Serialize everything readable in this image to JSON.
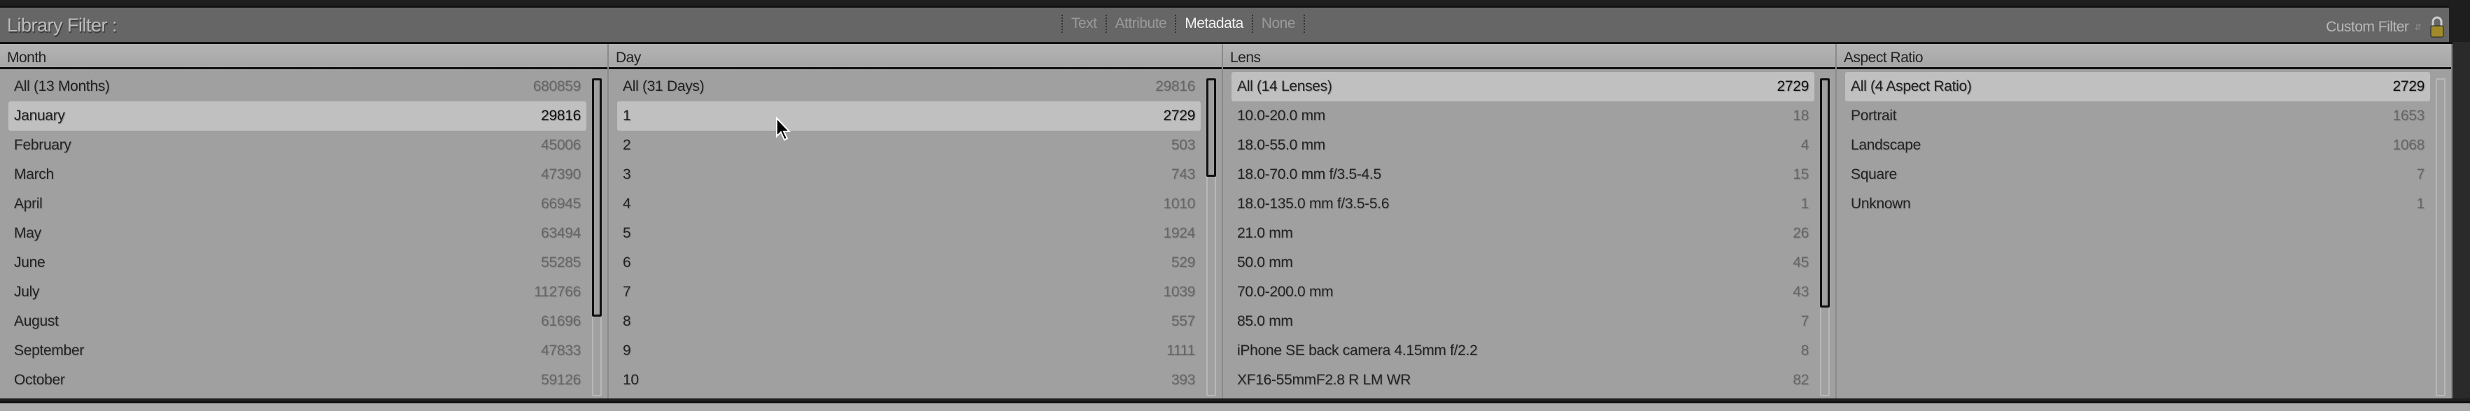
{
  "header": {
    "title": "Library Filter :",
    "modes": [
      "Text",
      "Attribute",
      "Metadata",
      "None"
    ],
    "active_mode": "Metadata",
    "preset": "Custom Filter"
  },
  "columns": [
    {
      "title": "Month",
      "items": [
        {
          "label": "All (13 Months)",
          "count": "680859"
        },
        {
          "label": "January",
          "count": "29816",
          "selected": true
        },
        {
          "label": "February",
          "count": "45006"
        },
        {
          "label": "March",
          "count": "47390"
        },
        {
          "label": "April",
          "count": "66945"
        },
        {
          "label": "May",
          "count": "63494"
        },
        {
          "label": "June",
          "count": "55285"
        },
        {
          "label": "July",
          "count": "112766"
        },
        {
          "label": "August",
          "count": "61696"
        },
        {
          "label": "September",
          "count": "47833"
        },
        {
          "label": "October",
          "count": "59126"
        }
      ],
      "scroll": 0.75
    },
    {
      "title": "Day",
      "items": [
        {
          "label": "All (31 Days)",
          "count": "29816"
        },
        {
          "label": "1",
          "count": "2729",
          "selected": true
        },
        {
          "label": "2",
          "count": "503"
        },
        {
          "label": "3",
          "count": "743"
        },
        {
          "label": "4",
          "count": "1010"
        },
        {
          "label": "5",
          "count": "1924"
        },
        {
          "label": "6",
          "count": "529"
        },
        {
          "label": "7",
          "count": "1039"
        },
        {
          "label": "8",
          "count": "557"
        },
        {
          "label": "9",
          "count": "1111"
        },
        {
          "label": "10",
          "count": "393"
        }
      ],
      "scroll": 0.31
    },
    {
      "title": "Lens",
      "items": [
        {
          "label": "All (14 Lenses)",
          "count": "2729",
          "selected": true
        },
        {
          "label": "10.0-20.0 mm",
          "count": "18"
        },
        {
          "label": "18.0-55.0 mm",
          "count": "4"
        },
        {
          "label": "18.0-70.0 mm f/3.5-4.5",
          "count": "15"
        },
        {
          "label": "18.0-135.0 mm f/3.5-5.6",
          "count": "1"
        },
        {
          "label": "21.0 mm",
          "count": "26"
        },
        {
          "label": "50.0 mm",
          "count": "45"
        },
        {
          "label": "70.0-200.0 mm",
          "count": "43"
        },
        {
          "label": "85.0 mm",
          "count": "7"
        },
        {
          "label": "iPhone SE back camera 4.15mm f/2.2",
          "count": "8"
        },
        {
          "label": "XF16-55mmF2.8 R LM WR",
          "count": "82"
        }
      ],
      "scroll": 0.72
    },
    {
      "title": "Aspect Ratio",
      "items": [
        {
          "label": "All (4 Aspect Ratio)",
          "count": "2729",
          "selected": true
        },
        {
          "label": "Portrait",
          "count": "1653"
        },
        {
          "label": "Landscape",
          "count": "1068"
        },
        {
          "label": "Square",
          "count": "7"
        },
        {
          "label": "Unknown",
          "count": "1"
        }
      ],
      "scroll": 0
    }
  ]
}
